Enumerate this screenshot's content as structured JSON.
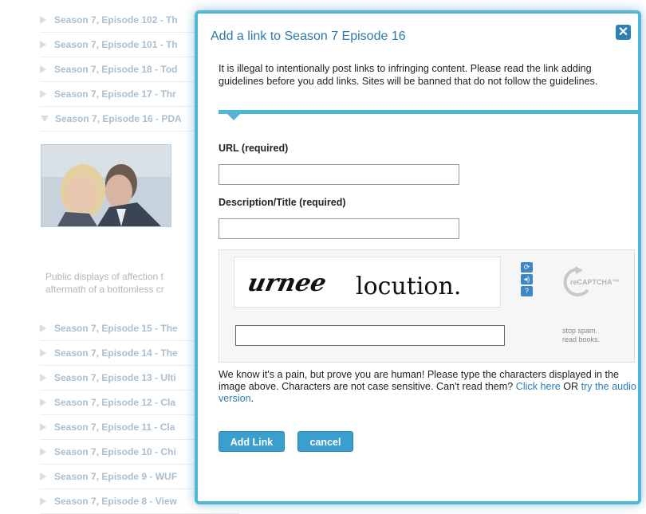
{
  "background": {
    "episodes_top": [
      "Season 7, Episode 102 - Th",
      "Season 7, Episode 101 - Th",
      "Season 7, Episode 18 - Tod",
      "Season 7, Episode 17 - Thr"
    ],
    "episode_expanded": "Season 7, Episode 16 - PDA",
    "episode_description_lines": [
      "Public displays of affection t",
      "aftermath of a bottomless cr"
    ],
    "episodes_bottom": [
      "Season 7, Episode 15 - The",
      "Season 7, Episode 14 - The",
      "Season 7, Episode 13 - Ulti",
      "Season 7, Episode 12 - Cla",
      "Season 7, Episode 11 - Cla",
      "Season 7, Episode 10 - Chi",
      "Season 7, Episode 9 - WUF",
      "Season 7, Episode 8 - View"
    ]
  },
  "modal": {
    "title": "Add a link to Season 7 Episode 16",
    "close_icon": "✕",
    "notice": "It is illegal to intentionally post links to infringing content. Please read the link adding guidelines before you add links. Sites will be banned that do not follow the guidelines.",
    "url_label": "URL (required)",
    "url_value": "",
    "desc_label": "Description/Title (required)",
    "desc_value": "",
    "captcha": {
      "word1": "urnee",
      "word2": "locution.",
      "reload_icon": "⟳",
      "audio_icon": "◂)",
      "help_icon": "?",
      "logo_text": "reCAPTCHA™",
      "response_value": "",
      "tagline_1": "stop spam.",
      "tagline_2": "read books."
    },
    "help_text": "We know it's a pain, but prove you are human! Please type the characters displayed in the image above. Characters are not case sensitive. Can't read them?",
    "click_here": "Click here",
    "or_text": "OR",
    "audio_link": "try the audio version",
    "period": ".",
    "add_button": "Add Link",
    "cancel_button": "cancel"
  },
  "colors": {
    "accent": "#4fb6d8",
    "button": "#3a9fcf",
    "link": "#2a7db5",
    "title": "#2c7aa7"
  }
}
